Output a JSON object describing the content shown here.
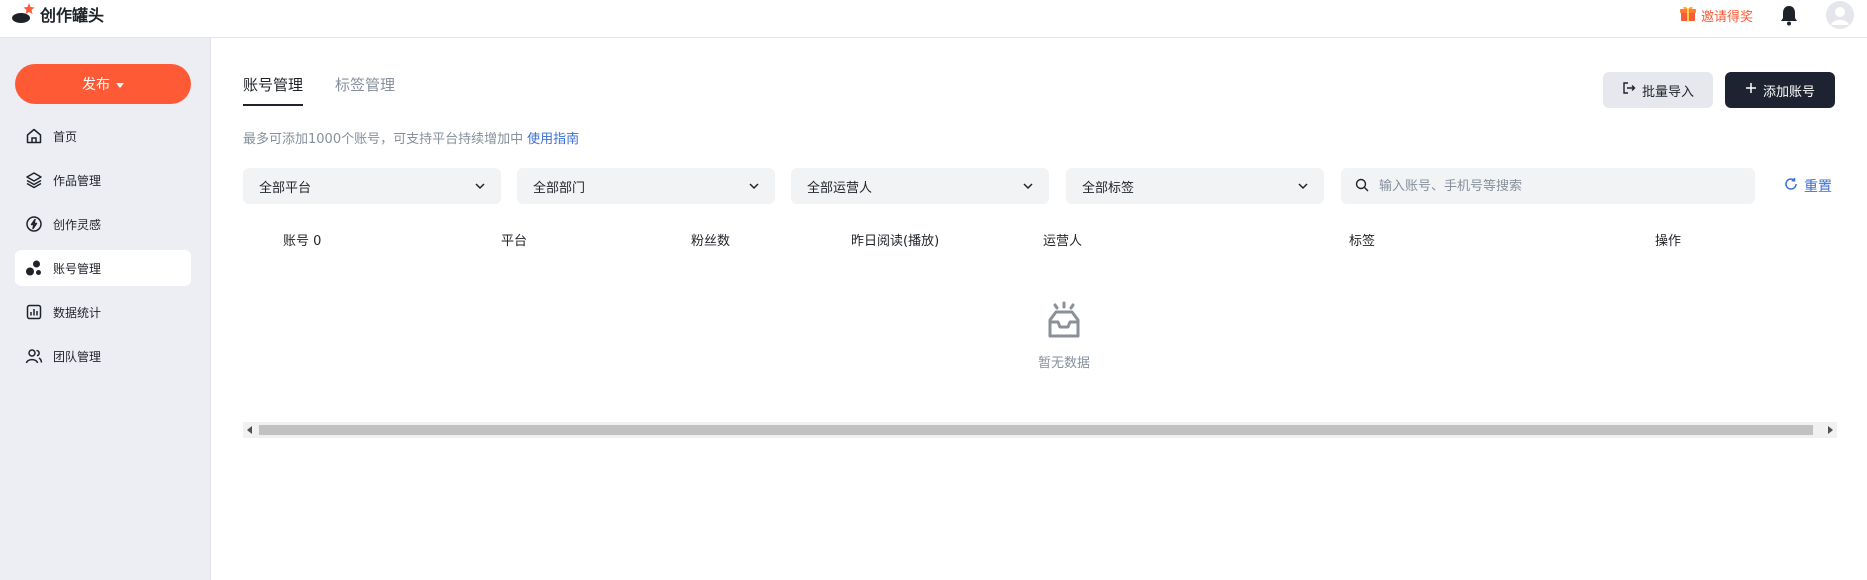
{
  "app": {
    "name": "创作罐头"
  },
  "topbar": {
    "invite_label": "邀请得奖"
  },
  "sidebar": {
    "publish_label": "发布",
    "items": [
      {
        "label": "首页",
        "icon": "home-icon"
      },
      {
        "label": "作品管理",
        "icon": "layers-icon"
      },
      {
        "label": "创作灵感",
        "icon": "bolt-icon"
      },
      {
        "label": "账号管理",
        "icon": "accounts-icon",
        "active": true
      },
      {
        "label": "数据统计",
        "icon": "chart-icon"
      },
      {
        "label": "团队管理",
        "icon": "team-icon"
      }
    ]
  },
  "main": {
    "tabs": [
      {
        "label": "账号管理",
        "active": true
      },
      {
        "label": "标签管理",
        "active": false
      }
    ],
    "hint": "最多可添加1000个账号，可支持平台持续增加中",
    "hint_link": "使用指南",
    "import_label": "批量导入",
    "add_label": "添加账号",
    "filters": {
      "platform": "全部平台",
      "department": "全部部门",
      "operator": "全部运营人",
      "tag": "全部标签"
    },
    "search_placeholder": "输入账号、手机号等搜索",
    "reset_label": "重置",
    "columns": [
      "账号 0",
      "平台",
      "粉丝数",
      "昨日阅读(播放)",
      "运营人",
      "标签",
      "操作"
    ],
    "empty_text": "暂无数据"
  },
  "colors": {
    "accent": "#ff5a36",
    "dark_button": "#1d2330",
    "link": "#3b6fd4"
  }
}
